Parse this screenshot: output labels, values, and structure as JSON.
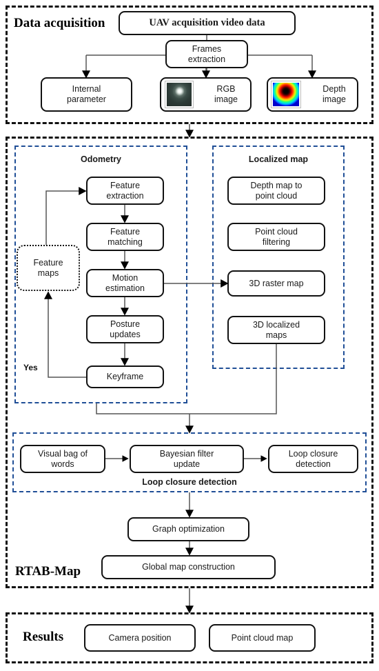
{
  "diagram": {
    "title": "RTAB-Map UAV visual SLAM pipeline",
    "colors": {
      "outer_section_border": "#111111",
      "inner_group_border": "#1F4E96",
      "box_border": "#111111",
      "connector": "#444444",
      "arrowhead": "#000000",
      "background": "#FFFFFF"
    }
  },
  "sections": {
    "data_acquisition": {
      "heading": "Data acquisition",
      "boxes": {
        "uav_video": "UAV acquisition video data",
        "frames_extraction": "Frames\nextraction",
        "internal_parameter": "Internal\nparameter",
        "rgb_image": "RGB\nimage",
        "depth_image": "Depth\nimage"
      },
      "thumbnails": {
        "rgb": "rgb-image-thumbnail",
        "depth": "depth-colormap-thumbnail"
      }
    },
    "rtab_map": {
      "heading": "RTAB-Map",
      "groups": {
        "odometry": {
          "title": "Odometry",
          "boxes": {
            "feature_extraction": "Feature\nextraction",
            "feature_matching": "Feature\nmatching",
            "motion_estimation": "Motion\nestimation",
            "posture_updates": "Posture\nupdates",
            "keyframe": "Keyframe",
            "feature_maps": "Feature\nmaps"
          },
          "labels": {
            "yes": "Yes"
          }
        },
        "localized_map": {
          "title": "Localized map",
          "boxes": {
            "depth_map_to_point_cloud": "Depth map to\npoint cloud",
            "point_cloud_filtering": "Point cloud\nfiltering",
            "raster_map_3d": "3D raster map",
            "localized_maps_3d": "3D localized\nmaps"
          }
        },
        "loop_closure": {
          "title": "Loop closure detection",
          "boxes": {
            "visual_bag_of_words": "Visual bag of\nwords",
            "bayesian_filter_update": "Bayesian filter\nupdate",
            "loop_closure_detection": "Loop closure\ndetection"
          }
        }
      },
      "boxes": {
        "graph_optimization": "Graph optimization",
        "global_map_construction": "Global map construction"
      }
    },
    "results": {
      "heading": "Results",
      "boxes": {
        "camera_position": "Camera position",
        "point_cloud_map": "Point cloud map"
      }
    }
  }
}
